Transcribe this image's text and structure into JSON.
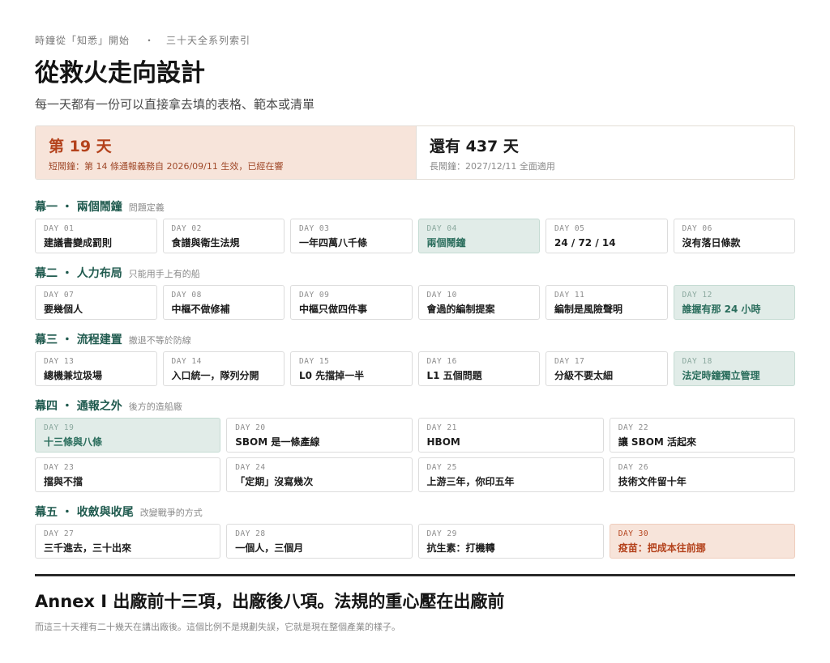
{
  "header": {
    "series": "時鐘從「知悉」開始",
    "separator": "・",
    "index": "三十天全系列索引",
    "title": "從救火走向設計",
    "subtitle": "每一天都有一份可以直接拿去填的表格、範本或清單"
  },
  "countdown": {
    "current_day": "第 19 天",
    "short_clock": "短鬧鐘：第 14 條通報義務自 2026/09/11 生效，已經在響",
    "remaining": "還有 437 天",
    "long_clock": "長鬧鐘：2027/12/11 全面適用"
  },
  "acts": [
    {
      "name": "幕一 ・ 兩個鬧鐘",
      "note": "問題定義",
      "days": [
        {
          "label": "DAY 01",
          "title": "建議書變成罰則",
          "style": ""
        },
        {
          "label": "DAY 02",
          "title": "食譜與衛生法規",
          "style": ""
        },
        {
          "label": "DAY 03",
          "title": "一年四萬八千條",
          "style": ""
        },
        {
          "label": "DAY 04",
          "title": "兩個鬧鐘",
          "style": "hl"
        },
        {
          "label": "DAY 05",
          "title": "24 / 72 / 14",
          "style": ""
        },
        {
          "label": "DAY 06",
          "title": "沒有落日條款",
          "style": ""
        }
      ]
    },
    {
      "name": "幕二 ・ 人力布局",
      "note": "只能用手上有的船",
      "days": [
        {
          "label": "DAY 07",
          "title": "要幾個人",
          "style": ""
        },
        {
          "label": "DAY 08",
          "title": "中樞不做修補",
          "style": ""
        },
        {
          "label": "DAY 09",
          "title": "中樞只做四件事",
          "style": ""
        },
        {
          "label": "DAY 10",
          "title": "會過的編制提案",
          "style": ""
        },
        {
          "label": "DAY 11",
          "title": "編制是風險聲明",
          "style": ""
        },
        {
          "label": "DAY 12",
          "title": "誰握有那 24 小時",
          "style": "hl"
        }
      ]
    },
    {
      "name": "幕三 ・ 流程建置",
      "note": "撤退不等於防線",
      "days": [
        {
          "label": "DAY 13",
          "title": "總機兼垃圾場",
          "style": ""
        },
        {
          "label": "DAY 14",
          "title": "入口統一，隊列分開",
          "style": ""
        },
        {
          "label": "DAY 15",
          "title": "L0 先擋掉一半",
          "style": ""
        },
        {
          "label": "DAY 16",
          "title": "L1 五個問題",
          "style": ""
        },
        {
          "label": "DAY 17",
          "title": "分級不要太細",
          "style": ""
        },
        {
          "label": "DAY 18",
          "title": "法定時鐘獨立管理",
          "style": "hl"
        }
      ]
    },
    {
      "name": "幕四 ・ 通報之外",
      "note": "後方的造船廠",
      "days": [
        {
          "label": "DAY 19",
          "title": "十三條與八條",
          "style": "hl"
        },
        {
          "label": "DAY 20",
          "title": "SBOM 是一條產線",
          "style": ""
        },
        {
          "label": "DAY 21",
          "title": "HBOM",
          "style": ""
        },
        {
          "label": "DAY 22",
          "title": "讓 SBOM 活起來",
          "style": ""
        },
        {
          "label": "DAY 23",
          "title": "擋與不擋",
          "style": ""
        },
        {
          "label": "DAY 24",
          "title": "「定期」沒寫幾次",
          "style": ""
        },
        {
          "label": "DAY 25",
          "title": "上游三年，你印五年",
          "style": ""
        },
        {
          "label": "DAY 26",
          "title": "技術文件留十年",
          "style": ""
        }
      ]
    },
    {
      "name": "幕五 ・ 收斂與收尾",
      "note": "改變戰爭的方式",
      "days": [
        {
          "label": "DAY 27",
          "title": "三千進去，三十出來",
          "style": ""
        },
        {
          "label": "DAY 28",
          "title": "一個人，三個月",
          "style": ""
        },
        {
          "label": "DAY 29",
          "title": "抗生素：打機轉",
          "style": ""
        },
        {
          "label": "DAY 30",
          "title": "疫苗：把成本往前挪",
          "style": "warm"
        }
      ]
    }
  ],
  "annex": {
    "title": "Annex I 出廠前十三項，出廠後八項。法規的重心壓在出廠前",
    "subtitle": "而這三十天裡有二十幾天在講出廠後。這個比例不是規劃失誤，它就是現在整個產業的樣子。"
  },
  "colors": {
    "accent_green": "#1f5a4e",
    "accent_orange": "#b4421c",
    "highlight_green_bg": "#e1ece8",
    "highlight_warm_bg": "#f7e4da"
  }
}
